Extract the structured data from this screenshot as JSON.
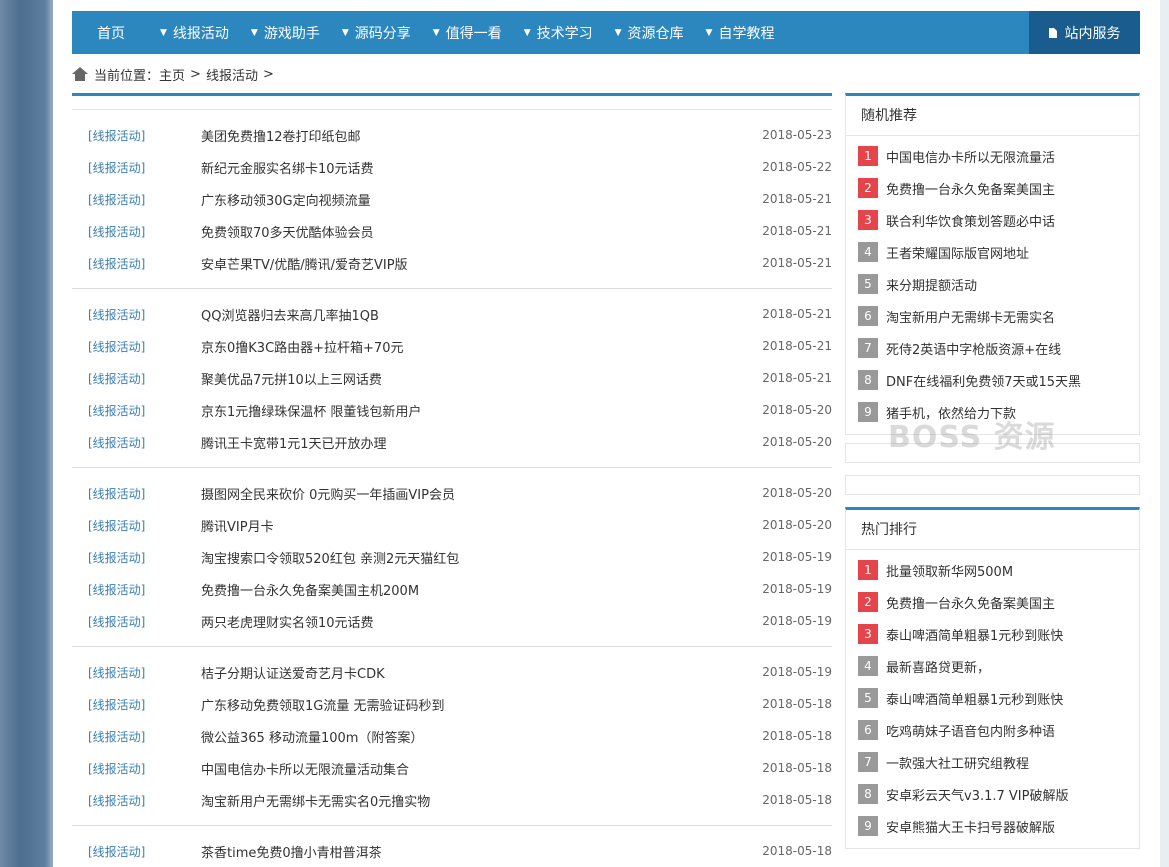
{
  "nav": {
    "home": "首页",
    "items": [
      "线报活动",
      "游戏助手",
      "源码分享",
      "值得一看",
      "技术学习",
      "资源仓库",
      "自学教程"
    ],
    "service": "站内服务"
  },
  "breadcrumb": {
    "prefix": "当前位置：",
    "home": "主页",
    "sep": ">",
    "current": "线报活动",
    "trail": ">"
  },
  "list": {
    "groups": [
      [
        {
          "cat": "[线报活动]",
          "title": "美团免费撸12卷打印纸包邮",
          "date": "2018-05-23"
        },
        {
          "cat": "[线报活动]",
          "title": "新纪元金服实名绑卡10元话费",
          "date": "2018-05-22"
        },
        {
          "cat": "[线报活动]",
          "title": "广东移动领30G定向视频流量",
          "date": "2018-05-21"
        },
        {
          "cat": "[线报活动]",
          "title": "免费领取70多天优酷体验会员",
          "date": "2018-05-21"
        },
        {
          "cat": "[线报活动]",
          "title": "安卓芒果TV/优酷/腾讯/爱奇艺VIP版",
          "date": "2018-05-21"
        }
      ],
      [
        {
          "cat": "[线报活动]",
          "title": "QQ浏览器归去来高几率抽1QB",
          "date": "2018-05-21"
        },
        {
          "cat": "[线报活动]",
          "title": "京东0撸K3C路由器+拉杆箱+70元",
          "date": "2018-05-21"
        },
        {
          "cat": "[线报活动]",
          "title": "聚美优品7元拼10以上三网话费",
          "date": "2018-05-21"
        },
        {
          "cat": "[线报活动]",
          "title": "京东1元撸绿珠保温杯 限董钱包新用户",
          "date": "2018-05-20"
        },
        {
          "cat": "[线报活动]",
          "title": "腾讯王卡宽带1元1天已开放办理",
          "date": "2018-05-20"
        }
      ],
      [
        {
          "cat": "[线报活动]",
          "title": "摄图网全民来砍价 0元购买一年插画VIP会员",
          "date": "2018-05-20"
        },
        {
          "cat": "[线报活动]",
          "title": "腾讯VIP月卡",
          "date": "2018-05-20"
        },
        {
          "cat": "[线报活动]",
          "title": "淘宝搜索口令领取520红包 亲测2元天猫红包",
          "date": "2018-05-19"
        },
        {
          "cat": "[线报活动]",
          "title": "免费撸一台永久免备案美国主机200M",
          "date": "2018-05-19"
        },
        {
          "cat": "[线报活动]",
          "title": "两只老虎理财实名领10元话费",
          "date": "2018-05-19"
        }
      ],
      [
        {
          "cat": "[线报活动]",
          "title": "桔子分期认证送爱奇艺月卡CDK",
          "date": "2018-05-19"
        },
        {
          "cat": "[线报活动]",
          "title": "广东移动免费领取1G流量 无需验证码秒到",
          "date": "2018-05-18"
        },
        {
          "cat": "[线报活动]",
          "title": "微公益365 移动流量100m（附答案）",
          "date": "2018-05-18"
        },
        {
          "cat": "[线报活动]",
          "title": "中国电信办卡所以无限流量活动集合",
          "date": "2018-05-18"
        },
        {
          "cat": "[线报活动]",
          "title": "淘宝新用户无需绑卡无需实名0元撸实物",
          "date": "2018-05-18"
        }
      ],
      [
        {
          "cat": "[线报活动]",
          "title": "茶香time免费0撸小青柑普洱茶",
          "date": "2018-05-18"
        }
      ]
    ]
  },
  "sidebar": {
    "random": {
      "title": "随机推荐",
      "items": [
        "中国电信办卡所以无限流量活",
        "免费撸一台永久免备案美国主",
        "联合利华饮食策划答题必中话",
        "王者荣耀国际版官网地址",
        "来分期提额活动",
        "淘宝新用户无需绑卡无需实名",
        "死侍2英语中字枪版资源+在线",
        "DNF在线福利免费领7天或15天黑",
        "猪手机，依然给力下款"
      ]
    },
    "hot": {
      "title": "热门排行",
      "items": [
        "批量领取新华网500M",
        "免费撸一台永久免备案美国主",
        "泰山啤酒简单粗暴1元秒到账快",
        "最新喜路贷更新，",
        "泰山啤酒简单粗暴1元秒到账快",
        "吃鸡萌妹子语音包内附多种语",
        "一款强大社工研究组教程",
        "安卓彩云天气v3.1.7 VIP破解版",
        "安卓熊猫大王卡扫号器破解版"
      ]
    },
    "numbers": [
      "1",
      "2",
      "3",
      "4",
      "5",
      "6",
      "7",
      "8",
      "9"
    ]
  },
  "watermark": "BOSS 资源",
  "colors": {
    "accent": "#2c87bf",
    "accent_dark": "#1a5c8e",
    "hot_rank": "#e5454a",
    "rank": "#999999",
    "category": "#3a7fb5"
  }
}
